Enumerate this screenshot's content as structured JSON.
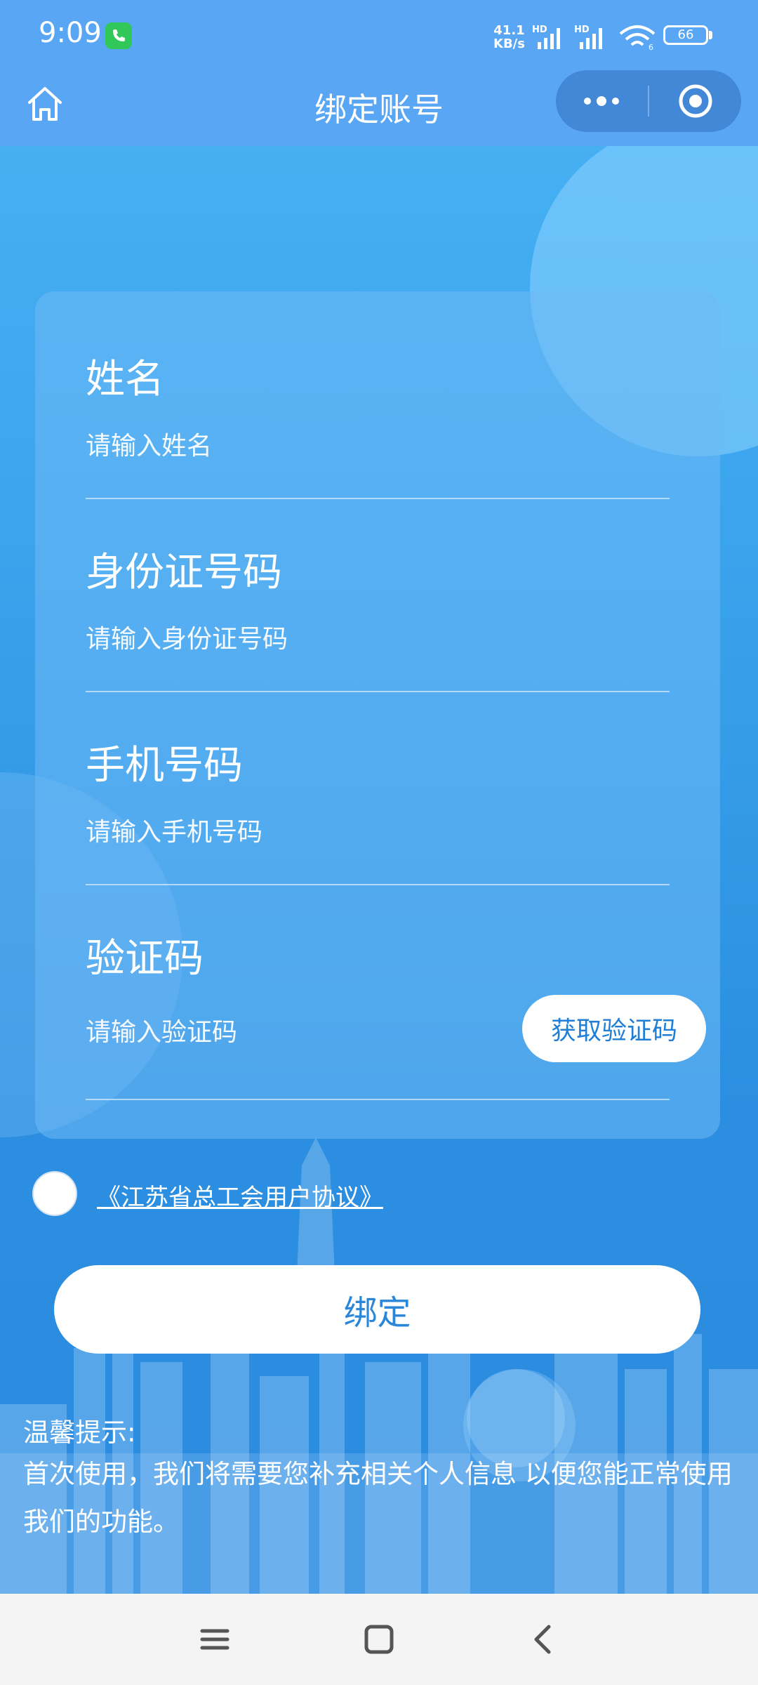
{
  "status_bar": {
    "time": "9:09",
    "net_speed_value": "41.1",
    "net_speed_unit": "KB/s",
    "sim1_label": "HD",
    "sim2_label": "HD",
    "wifi_label": "6",
    "battery": "66"
  },
  "nav": {
    "title": "绑定账号"
  },
  "form": {
    "name_label": "姓名",
    "name_placeholder": "请输入姓名",
    "id_label": "身份证号码",
    "id_placeholder": "请输入身份证号码",
    "phone_label": "手机号码",
    "phone_placeholder": "请输入手机号码",
    "code_label": "验证码",
    "code_placeholder": "请输入验证码",
    "get_code_button": "获取验证码"
  },
  "agreement": {
    "link_text": "《江苏省总工会用户协议》",
    "checked": false
  },
  "bind_button": "绑定",
  "tip": {
    "title": "温馨提示:",
    "text": "首次使用，我们将需要您补充相关个人信息 以便您能正常使用我们的功能。"
  },
  "colors": {
    "bar": "#59a6f5",
    "accent_text": "#2a86d8",
    "call_badge": "#32c759"
  }
}
